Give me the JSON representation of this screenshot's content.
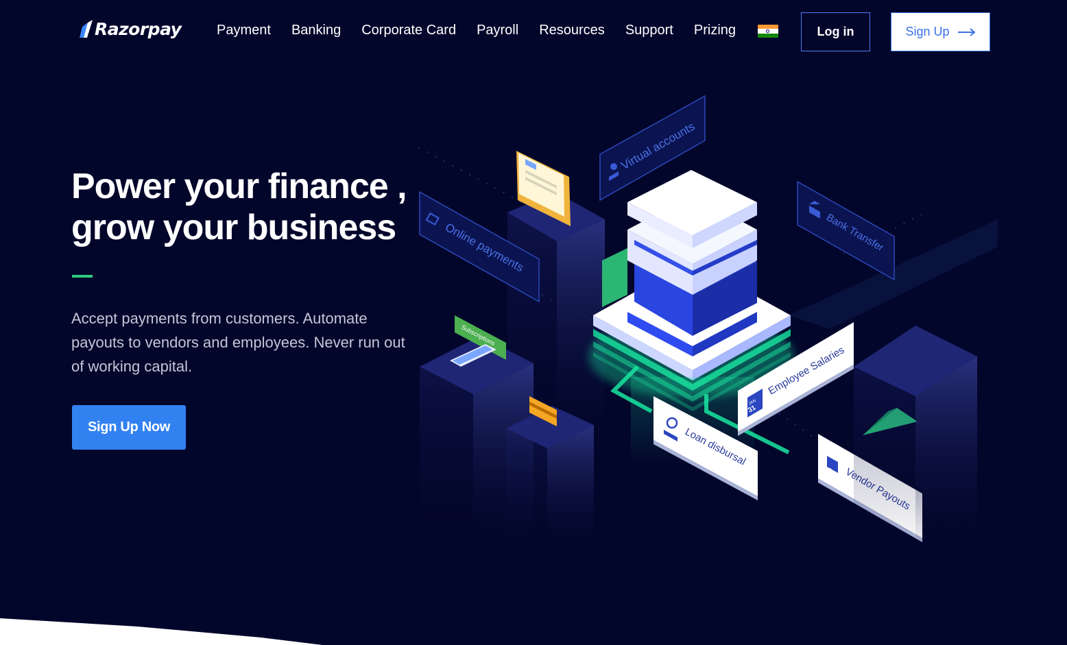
{
  "brand": {
    "name": "Razorpay"
  },
  "nav": {
    "items": [
      {
        "label": "Payment"
      },
      {
        "label": "Banking"
      },
      {
        "label": "Corporate Card"
      },
      {
        "label": "Payroll"
      },
      {
        "label": "Resources"
      },
      {
        "label": "Support"
      },
      {
        "label": "Prizing"
      }
    ],
    "flag_icon": "india-flag-icon",
    "login_label": "Log in",
    "signup_label": "Sign Up",
    "signup_icon": "arrow-right-icon"
  },
  "hero": {
    "title_line1": "Power your finance ,",
    "title_line2": "grow your business",
    "description": "Accept payments from customers. Automate payouts to vendors and employees. Never run out of working capital.",
    "cta_label": "Sign Up Now"
  },
  "illustration": {
    "labels": {
      "virtual_accounts": "Virtual accounts",
      "online_payments": "Online payments",
      "bank_transfer": "Bank Transfer",
      "subscriptions": "Subscriptions",
      "employee_salaries": "Employee Salaries",
      "loan_disbursal": "Loan disbursal",
      "vendor_payouts": "Vendor Payouts",
      "calendar_month": "JAN",
      "calendar_day": "31"
    }
  },
  "colors": {
    "background": "#03062b",
    "primary_blue": "#3281f1",
    "accent_green": "#31c981",
    "neon_green": "#19e6a0",
    "text_muted": "#c4c6d8"
  }
}
